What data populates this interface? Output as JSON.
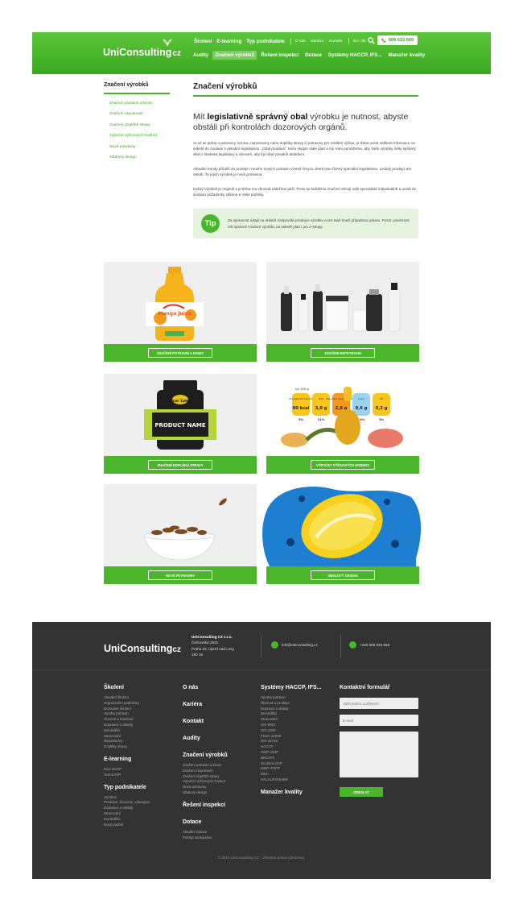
{
  "header": {
    "logo_text": "UniConsulting",
    "logo_suffix": "cz",
    "top_links": [
      "Školení",
      "E-learning",
      "Typ podnikatele"
    ],
    "small_links": [
      "O nás",
      "Kariéra",
      "Kontakt",
      "En / Sk"
    ],
    "phone": "606 615 569",
    "main_nav": [
      "Audity",
      "Značení výrobků",
      "Řešení inspekcí",
      "Dotace",
      "Systémy HACCP, IFS...",
      "Manažer kvality"
    ],
    "active_nav_index": 1
  },
  "sidebar": {
    "title": "Značení výrobků",
    "items": [
      "Značení potravin a krmiv",
      "Značení nepotravin",
      "Značení doplňků stravy",
      "Výpočet výživových hodnot",
      "Nové potraviny",
      "Obalový design"
    ]
  },
  "main": {
    "title": "Značení výrobků",
    "lead_pre": "Mít ",
    "lead_bold": "legislativně správný obal",
    "lead_post": " výrobku je nutnost, abyste obstáli při kontrolách dozorových orgánů.",
    "p1": "At už se jedná o potraviny, krmiva, nepotraviny nebo doplňky stravy či potraviny pro zvláštní výživu, je třeba uvést veškeré informace na etiketě do souladu s aktuální legislativou. „Obal prodává“, tento slogan stále platí a my Vám pomůžeme, aby Vaše výrobky měly správný obal z hlediska legislativy a zároveň, aby byl obal vizuálně atraktivní.",
    "p2": "Aktuální trendy přináší do prodeje i mnoho nových potravin včetně hmyzu, které jsou řízený speciální legislativou. Leckdy prodejci ani netuší, že jejich výrobek je nová potravina.",
    "p3": "Každý výrobek je originál a je třeba mu věnovat náležitou péči. Proto se každému značení věnují naši specialisté individuálně a uvádí do souladu požadavky zákona a Vaše potřeby.",
    "tip_label": "Tip",
    "tip_text": "Za správnost údajů na etiketě zodpovídá prodejce výrobku a ten také hradí případnou pokutu. Pozor, povinnost mít správné značení výrobku na etiketě platí i pro e-shopy."
  },
  "cards": [
    {
      "label": "ZNAČENÍ POTRAVIN A KRMIV",
      "image": "juice-bottle"
    },
    {
      "label": "ZNAČENÍ NEPOTRAVIN",
      "image": "cosmetics"
    },
    {
      "label": "ZNAČENÍ DOPLŇKŮ STRAVY",
      "image": "supplement-jar"
    },
    {
      "label": "VÝPOČET VÝŽIVOVÝCH HODNOT",
      "image": "nutrition-values"
    },
    {
      "label": "NOVÉ POTRAVINY",
      "image": "insects-bowl"
    },
    {
      "label": "OBALOVÝ DESIGN",
      "image": "lemon-splash"
    }
  ],
  "juice_label": "Mango Juice",
  "supplement_label": {
    "logo": "Your Logo",
    "name": "PRODUCT NAME"
  },
  "nutrition": {
    "per": "na 100 g",
    "items": [
      {
        "name": "Energetická hodnota",
        "value": "90 kcal",
        "pct": "5%",
        "color": "#f7c51b"
      },
      {
        "name": "Tuky",
        "value": "3,0 g",
        "pct": "11%",
        "color": "#f7c51b"
      },
      {
        "name": "Nasycené mastné kyseliny",
        "value": "2,0 g",
        "pct": "4%",
        "color": "#f39a1d"
      },
      {
        "name": "Cukry",
        "value": "9,6 g",
        "pct": "14%",
        "color": "#9bd3ef"
      },
      {
        "name": "Sůl",
        "value": "0,2 g",
        "pct": "3%",
        "color": "#f7c51b"
      }
    ]
  },
  "footer": {
    "logo_text": "UniConsulting",
    "logo_suffix": "cz",
    "company": "UniConsulting CZ s.r.o.",
    "street": "Čerkovská 2621",
    "city": "Praha 25, Újezd nad Lesy",
    "zip": "190 16",
    "email": "info@uniconsulting.cz",
    "phone": "+420 606 615 569",
    "col1": [
      {
        "h": "Školení",
        "items": [
          "Aktuální školení",
          "Organizační podmínky",
          "Dotované školení",
          "Výroba potravin",
          "Ovesné a hotelové",
          "Dopravce a sklady",
          "Zemědělci",
          "Stravování",
          "Nepotraviny",
          "Doplňky stravy"
        ]
      },
      {
        "h": "E-learning",
        "items": [
          "Kurz DAVP",
          "Test DAVP"
        ]
      },
      {
        "h": "Typ podnikatele",
        "items": [
          "Výrobce",
          "Prodejce, dovozce, výkoupce",
          "Dopravce a sklady",
          "Stravování",
          "Zemědělci",
          "Nový podnik"
        ]
      }
    ],
    "col2": [
      {
        "h": "O nás",
        "items": []
      },
      {
        "h": "Kariéra",
        "items": []
      },
      {
        "h": "Kontakt",
        "items": []
      },
      {
        "h": "Audity",
        "items": []
      },
      {
        "h": "Značení výrobků",
        "items": [
          "Značení potravin a krmiv",
          "Značení nepotravin",
          "Značení doplňků stravy",
          "Výpočet výživových hodnot",
          "Nové potraviny",
          "Obalový design"
        ]
      },
      {
        "h": "Řešení inspekcí",
        "items": []
      },
      {
        "h": "Dotace",
        "items": [
          "Aktuální dotace",
          "Postup spolupráce"
        ]
      }
    ],
    "col3": [
      {
        "h": "Systémy HACCP, IFS...",
        "items": [
          "Výroba potravin",
          "Obchod a prodejci",
          "Dopravci a sklady",
          "Zemědělci",
          "Stravování",
          "ISO 9001",
          "ISO 2200",
          "FSSC 22000",
          "ISO 22716",
          "HACCP",
          "GMP+GHP",
          "BRC/IFS",
          "GLOBALGAP",
          "GMP+FSFP",
          "MSC",
          "HALAL/KOSHER"
        ]
      },
      {
        "h": "Manažer kvality",
        "items": []
      }
    ],
    "form": {
      "title": "Kontaktní formulář",
      "name_placeholder": "Vaše jméno a příjmení",
      "email_placeholder": "E-mail",
      "message_placeholder": "",
      "send_label": "ODESLAT"
    },
    "copyright": "©  2019  UniConsulting CZ - Všechna práva vyhrazena."
  },
  "colors": {
    "green": "#49b52a",
    "green_light": "#e6f3df",
    "footer_bg": "#333333"
  }
}
